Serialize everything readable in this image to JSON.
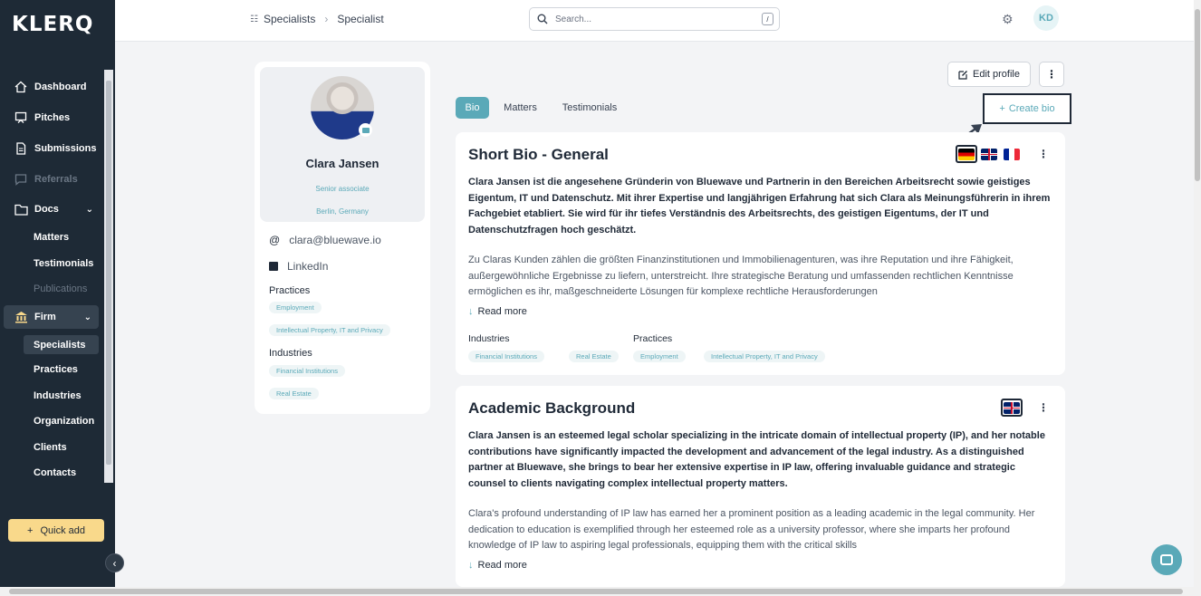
{
  "brand": {
    "logo": "KLERQ"
  },
  "sidebar": {
    "items": [
      {
        "label": "Dashboard"
      },
      {
        "label": "Pitches"
      },
      {
        "label": "Submissions"
      },
      {
        "label": "Referrals"
      },
      {
        "label": "Docs"
      }
    ],
    "docs_sub": [
      "Matters",
      "Testimonials",
      "Publications"
    ],
    "firm_label": "Firm",
    "firm_sub": [
      "Specialists",
      "Practices",
      "Industries",
      "Organization",
      "Clients",
      "Contacts"
    ],
    "quick_add": "Quick add",
    "collapse_icon": "chevron-left-icon"
  },
  "topbar": {
    "breadcrumb": [
      "Specialists",
      "Specialist"
    ],
    "search_placeholder": "Search...",
    "search_shortcut": "/",
    "user_initials": "KD"
  },
  "profile": {
    "name": "Clara Jansen",
    "role": "Senior associate",
    "location": "Berlin, Germany",
    "email": "clara@bluewave.io",
    "linkedin": "LinkedIn",
    "practices_label": "Practices",
    "practices": [
      "Employment",
      "Intellectual Property, IT and Privacy"
    ],
    "industries_label": "Industries",
    "industries": [
      "Financial Institutions",
      "Real Estate"
    ]
  },
  "actions": {
    "edit_profile": "Edit profile",
    "create_bio": "Create bio"
  },
  "tabs": [
    {
      "label": "Bio",
      "active": true
    },
    {
      "label": "Matters"
    },
    {
      "label": "Testimonials"
    }
  ],
  "bios": [
    {
      "title": "Short Bio - General",
      "bold": "Clara Jansen ist die angesehene Gründerin von Bluewave und Partnerin in den Bereichen Arbeitsrecht sowie geistiges Eigentum, IT und Datenschutz. Mit ihrer Expertise und langjährigen Erfahrung hat sich Clara als Meinungsführerin in ihrem Fachgebiet etabliert. Sie wird für ihr tiefes Verständnis des Arbeitsrechts, des geistigen Eigentums, der IT und Datenschutzfragen hoch geschätzt.",
      "text": "Zu Claras Kunden zählen die größten Finanzinstitutionen und Immobilienagenturen, was ihre Reputation und ihre Fähigkeit, außergewöhnliche Ergebnisse zu liefern, unterstreicht. Ihre strategische Beratung und umfassenden rechtlichen Kenntnisse ermöglichen es ihr, maßgeschneiderte Lösungen für komplexe rechtliche Herausforderungen",
      "read_more": "Read more",
      "industries_label": "Industries",
      "industries": [
        "Financial Institutions",
        "Real Estate"
      ],
      "practices_label": "Practices",
      "practices": [
        "Employment",
        "Intellectual Property, IT and Privacy"
      ]
    },
    {
      "title": "Academic Background",
      "bold": "Clara Jansen is an esteemed legal scholar specializing in the intricate domain of intellectual property (IP), and her notable contributions have significantly impacted the development and advancement of the legal industry. As a distinguished partner at Bluewave, she brings to bear her extensive expertise in IP law, offering invaluable guidance and strategic counsel to clients navigating complex intellectual property matters.",
      "text": "Clara's profound understanding of IP law has earned her a prominent position as a leading academic in the legal community. Her dedication to education is exemplified through her esteemed role as a university professor, where she imparts her profound knowledge of IP law to aspiring legal professionals, equipping them with the critical skills",
      "read_more": "Read more"
    }
  ],
  "colors": {
    "accent": "#5aa9b8",
    "sidebar": "#1e2a36",
    "quick_add": "#f9d98b"
  }
}
